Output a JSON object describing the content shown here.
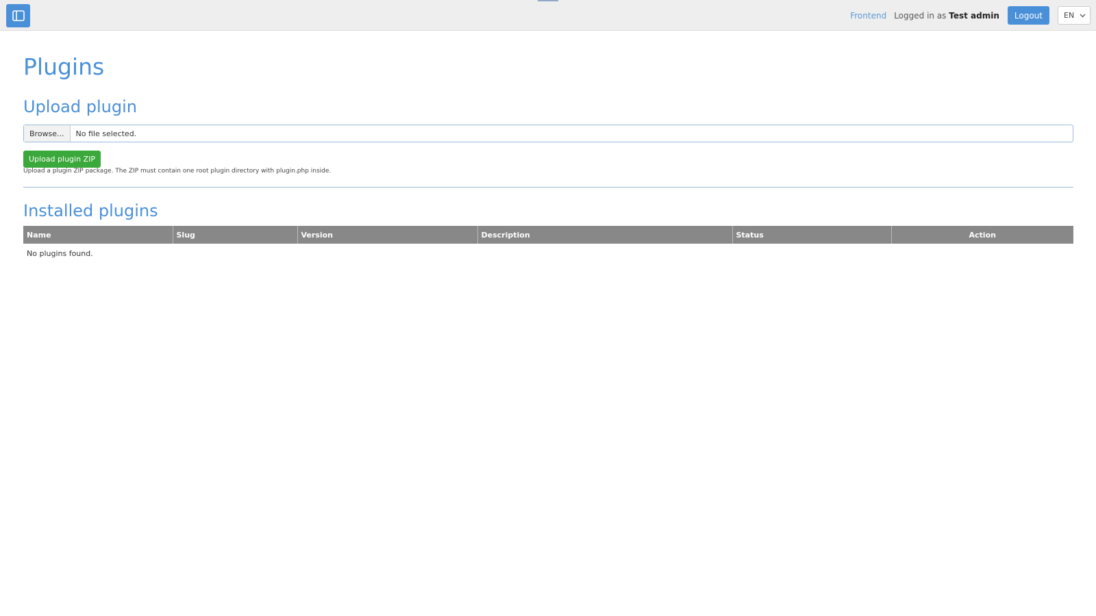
{
  "header": {
    "sidebar_toggle_icon": "sidebar-icon",
    "frontend_link": "Frontend",
    "logged_in_prefix": "Logged in as",
    "user_name": "Test admin",
    "logout_label": "Logout",
    "language": "EN",
    "language_icon": "chevron-down-icon"
  },
  "page": {
    "title": "Plugins"
  },
  "upload": {
    "title": "Upload plugin",
    "browse_label": "Browse...",
    "file_status": "No file selected.",
    "submit_label": "Upload plugin ZIP",
    "help_text": "Upload a plugin ZIP package. The ZIP must contain one root plugin directory with plugin.php inside."
  },
  "installed": {
    "title": "Installed plugins",
    "columns": [
      "Name",
      "Slug",
      "Version",
      "Description",
      "Status",
      "Action"
    ],
    "empty_message": "No plugins found."
  },
  "colors": {
    "accent": "#4a90d9",
    "success": "#3aa83a",
    "table_header": "#888888"
  }
}
